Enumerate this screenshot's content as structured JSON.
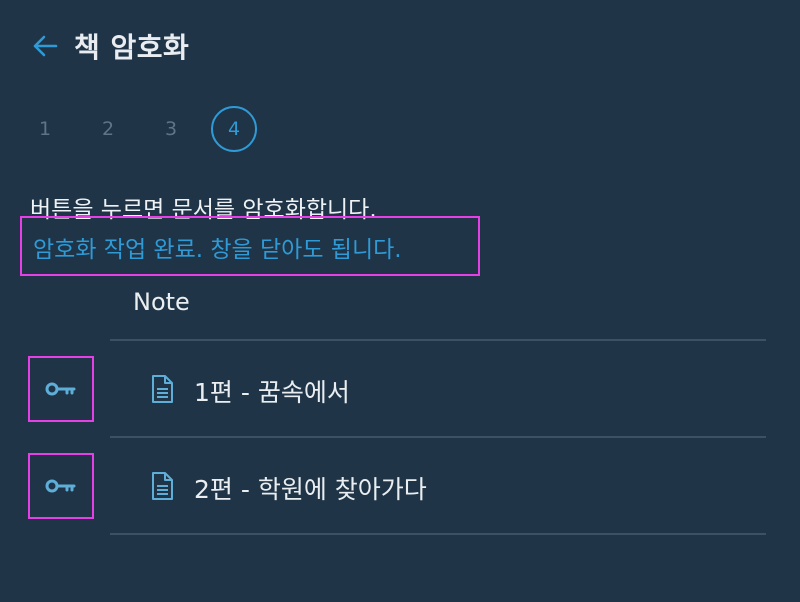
{
  "header": {
    "title": "책 암호화"
  },
  "steps": [
    "1",
    "2",
    "3",
    "4"
  ],
  "active_step": "4",
  "description": "버튼을 누르면 문서를 암호화합니다.",
  "status": "암호화 작업 완료. 창을 닫아도 됩니다.",
  "table": {
    "column_header": "Note",
    "rows": [
      {
        "label": "1편 - 꿈속에서"
      },
      {
        "label": "2편 - 학원에 찾아가다"
      }
    ]
  },
  "colors": {
    "accent": "#2f9ad6",
    "background": "#1f3447",
    "highlight": "#e440e6"
  },
  "icons": {
    "back": "arrow-left-icon",
    "key": "key-icon",
    "document": "document-icon"
  }
}
